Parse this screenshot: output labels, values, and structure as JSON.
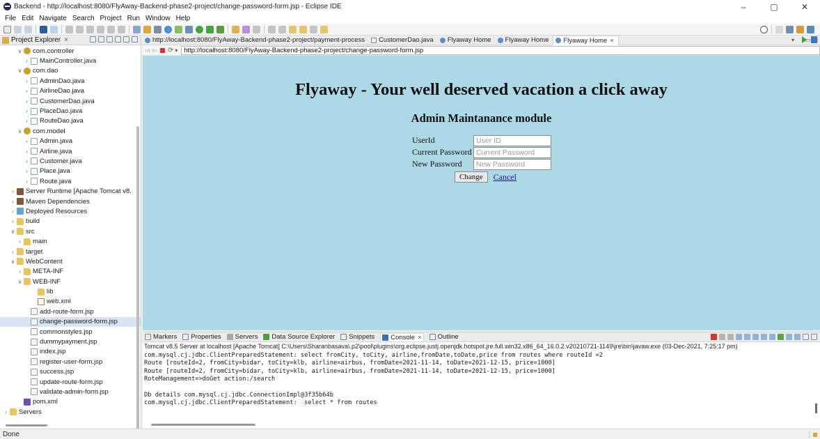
{
  "window": {
    "title": "Backend - http://localhost:8080/FlyAway-Backend-phase2-project/change-password-form.jsp - Eclipse IDE",
    "controls": {
      "minimize": "–",
      "maximize": "▢",
      "close": "✕"
    }
  },
  "menu": [
    "File",
    "Edit",
    "Navigate",
    "Search",
    "Project",
    "Run",
    "Window",
    "Help"
  ],
  "project_explorer": {
    "title": "Project Explorer",
    "items": [
      {
        "label": "com.controller",
        "twisty": "∨",
        "icon": "package-icon"
      },
      {
        "label": "MainController.java",
        "twisty": "›",
        "icon": "java-file-icon"
      },
      {
        "label": "com.dao",
        "twisty": "∨",
        "icon": "package-icon"
      },
      {
        "label": "AdminDao.java",
        "twisty": "›",
        "icon": "java-file-icon"
      },
      {
        "label": "AirlineDao.java",
        "twisty": "›",
        "icon": "java-file-icon"
      },
      {
        "label": "CustomerDao.java",
        "twisty": "›",
        "icon": "java-file-icon"
      },
      {
        "label": "PlaceDao.java",
        "twisty": "›",
        "icon": "java-file-icon"
      },
      {
        "label": "RouteDao.java",
        "twisty": "›",
        "icon": "java-file-icon"
      },
      {
        "label": "com.model",
        "twisty": "∨",
        "icon": "package-icon"
      },
      {
        "label": "Admin.java",
        "twisty": "›",
        "icon": "java-file-icon"
      },
      {
        "label": "Airline.java",
        "twisty": "›",
        "icon": "java-file-icon"
      },
      {
        "label": "Customer.java",
        "twisty": "›",
        "icon": "java-file-icon"
      },
      {
        "label": "Place.java",
        "twisty": "›",
        "icon": "java-file-icon"
      },
      {
        "label": "Route.java",
        "twisty": "›",
        "icon": "java-file-icon"
      },
      {
        "label": "Server Runtime [Apache Tomcat v8.",
        "twisty": "›",
        "icon": "library-icon"
      },
      {
        "label": "Maven Dependencies",
        "twisty": "›",
        "icon": "library-icon"
      },
      {
        "label": "Deployed Resources",
        "twisty": "›",
        "icon": "deployed-resources-icon"
      },
      {
        "label": "build",
        "twisty": "›",
        "icon": "folder-icon"
      },
      {
        "label": "src",
        "twisty": "∨",
        "icon": "folder-icon"
      },
      {
        "label": "main",
        "twisty": "›",
        "icon": "folder-icon"
      },
      {
        "label": "target",
        "twisty": "›",
        "icon": "folder-icon"
      },
      {
        "label": "WebContent",
        "twisty": "∨",
        "icon": "folder-icon"
      },
      {
        "label": "META-INF",
        "twisty": "›",
        "icon": "folder-icon"
      },
      {
        "label": "WEB-INF",
        "twisty": "∨",
        "icon": "folder-icon"
      },
      {
        "label": "lib",
        "twisty": "",
        "icon": "folder-icon"
      },
      {
        "label": "web.xml",
        "twisty": "",
        "icon": "xml-file-icon"
      },
      {
        "label": "add-route-form.jsp",
        "twisty": "",
        "icon": "jsp-file-icon"
      },
      {
        "label": "change-password-form.jsp",
        "twisty": "",
        "icon": "jsp-file-icon",
        "selected": true
      },
      {
        "label": "commonstyles.jsp",
        "twisty": "",
        "icon": "jsp-file-icon"
      },
      {
        "label": "dummypayment.jsp",
        "twisty": "",
        "icon": "jsp-file-icon"
      },
      {
        "label": "index.jsp",
        "twisty": "",
        "icon": "jsp-file-icon"
      },
      {
        "label": "register-user-form.jsp",
        "twisty": "",
        "icon": "jsp-file-icon"
      },
      {
        "label": "success.jsp",
        "twisty": "",
        "icon": "jsp-file-icon"
      },
      {
        "label": "update-route-form.jsp",
        "twisty": "",
        "icon": "jsp-file-icon"
      },
      {
        "label": "validate-admin-form.jsp",
        "twisty": "",
        "icon": "jsp-file-icon"
      },
      {
        "label": "pom.xml",
        "twisty": "",
        "icon": "pom-file-icon"
      },
      {
        "label": "Servers",
        "twisty": "›",
        "icon": "folder-icon"
      }
    ]
  },
  "editor": {
    "tabs": [
      {
        "label": "http://localhost:8080/FlyAway-Backend-phase2-project/payment-process",
        "icon": "browser-icon"
      },
      {
        "label": "CustomerDao.java",
        "icon": "java-file-icon"
      },
      {
        "label": "Flyaway Home",
        "icon": "browser-icon"
      },
      {
        "label": "Flyaway Home",
        "icon": "browser-icon"
      },
      {
        "label": "Flyaway Home",
        "icon": "browser-icon",
        "active": true
      }
    ],
    "url": "http://localhost:8080/FlyAway-Backend-phase2-project/change-password-form.jsp"
  },
  "webpage": {
    "heading": "Flyaway - Your well deserved vacation a click away",
    "subheading": "Admin Maintanance module",
    "form": {
      "userid_label": "UserId",
      "userid_placeholder": "User ID",
      "current_label": "Current Password",
      "current_placeholder": "Current Password",
      "new_label": "New Password",
      "new_placeholder": "New Password",
      "submit_label": "Change",
      "cancel_label": "Cancel"
    },
    "background_color": "#add8e6"
  },
  "console": {
    "tabs": [
      {
        "label": "Markers",
        "icon": "markers-icon"
      },
      {
        "label": "Properties",
        "icon": "properties-icon"
      },
      {
        "label": "Servers",
        "icon": "servers-icon"
      },
      {
        "label": "Data Source Explorer",
        "icon": "data-source-icon"
      },
      {
        "label": "Snippets",
        "icon": "snippets-icon"
      },
      {
        "label": "Console",
        "icon": "console-icon",
        "active": true
      },
      {
        "label": "Outline",
        "icon": "outline-icon"
      }
    ],
    "status": "Tomcat v8.5 Server at localhost [Apache Tomcat] C:\\Users\\Sharanbasava\\.p2\\pool\\plugins\\org.eclipse.justj.openjdk.hotspot.jre.full.win32.x86_64_16.0.2.v20210721-1149\\jre\\bin\\javaw.exe  (03-Dec-2021, 7:25:17 pm)",
    "lines": [
      "com.mysql.cj.jdbc.ClientPreparedStatement: select fromCity, toCity, airline,fromDate,toDate,price from routes where routeId =2",
      "Route [routeId=2, fromCity=bidar, toCity=klb, airline=airbus, fromDate=2021-11-14, toDate=2021-12-15, price=1000]",
      "Route [routeId=2, fromCity=bidar, toCity=klb, airline=airbus, fromDate=2021-11-14, toDate=2021-12-15, price=1000]",
      "RoteManagement=>doGet action:/search",
      "",
      "Db details com.mysql.cj.jdbc.ConnectionImpl@3f35b64b",
      "com.mysql.cj.jdbc.ClientPreparedStatement:  select * from routes"
    ]
  },
  "statusbar": {
    "text": "Done"
  }
}
